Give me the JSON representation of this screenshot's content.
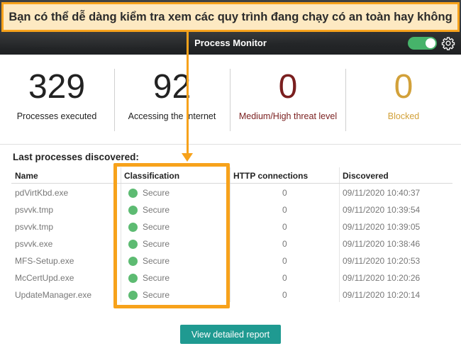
{
  "callout": {
    "text": "Bạn có thể dễ dàng kiểm tra xem các quy trình đang chạy có an toàn hay không"
  },
  "header": {
    "title": "Process Monitor",
    "toggle_on": true,
    "icons": [
      "toggle-switch",
      "gear-icon"
    ]
  },
  "stats": [
    {
      "value": "329",
      "label": "Processes executed",
      "color": "#222222"
    },
    {
      "value": "92",
      "label": "Accessing the Internet",
      "color": "#222222"
    },
    {
      "value": "0",
      "label": "Medium/High threat level",
      "color": "#7a1f1f"
    },
    {
      "value": "0",
      "label": "Blocked",
      "color": "#d2a13a"
    }
  ],
  "table": {
    "title": "Last processes discovered:",
    "columns": [
      "Name",
      "Classification",
      "HTTP connections",
      "Discovered"
    ],
    "rows": [
      {
        "name": "pdVirtKbd.exe",
        "classification": "Secure",
        "http": "0",
        "discovered": "09/11/2020 10:40:37"
      },
      {
        "name": "psvvk.tmp",
        "classification": "Secure",
        "http": "0",
        "discovered": "09/11/2020 10:39:54"
      },
      {
        "name": "psvvk.tmp",
        "classification": "Secure",
        "http": "0",
        "discovered": "09/11/2020 10:39:05"
      },
      {
        "name": "psvvk.exe",
        "classification": "Secure",
        "http": "0",
        "discovered": "09/11/2020 10:38:46"
      },
      {
        "name": "MFS-Setup.exe",
        "classification": "Secure",
        "http": "0",
        "discovered": "09/11/2020 10:20:53"
      },
      {
        "name": "McCertUpd.exe",
        "classification": "Secure",
        "http": "0",
        "discovered": "09/11/2020 10:20:26"
      },
      {
        "name": "UpdateManager.exe",
        "classification": "Secure",
        "http": "0",
        "discovered": "09/11/2020 10:20:14"
      }
    ]
  },
  "actions": {
    "report_label": "View detailed report"
  },
  "colors": {
    "accent_orange": "#f7a21b",
    "secure_green": "#5dbb72",
    "button_teal": "#1f9a91"
  }
}
